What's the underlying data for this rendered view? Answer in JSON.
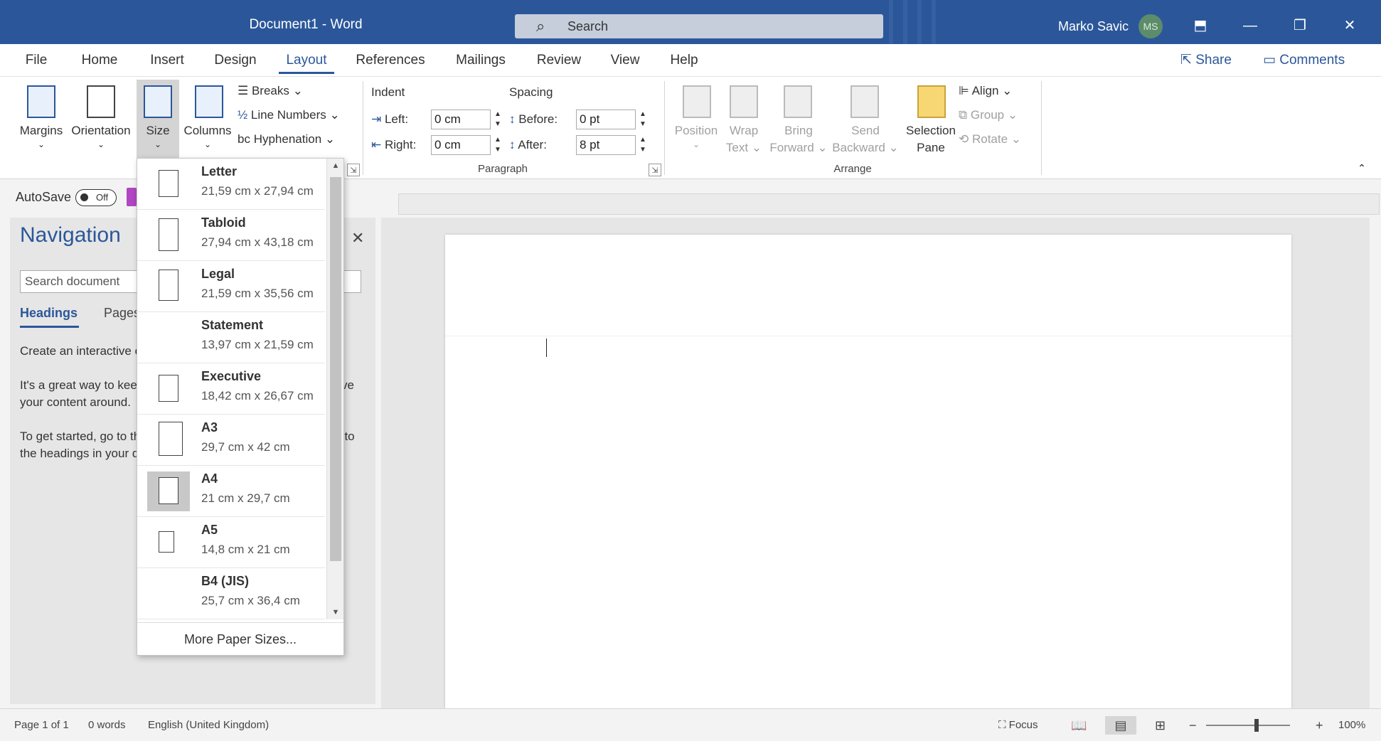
{
  "titlebar": {
    "doc_title": "Document1  -  Word",
    "search_placeholder": "Search",
    "user_name": "Marko Savic",
    "user_initials": "MS",
    "ribbon_display_glyph": "⬒",
    "minimize_glyph": "—",
    "restore_glyph": "❐",
    "close_glyph": "✕"
  },
  "tabs": [
    "File",
    "Home",
    "Insert",
    "Design",
    "Layout",
    "References",
    "Mailings",
    "Review",
    "View",
    "Help"
  ],
  "active_tab": "Layout",
  "share_label": "Share",
  "comments_label": "Comments",
  "ribbon": {
    "page_setup": {
      "margins": "Margins",
      "orientation": "Orientation",
      "size": "Size",
      "columns": "Columns",
      "breaks": "Breaks",
      "line_numbers": "Line Numbers",
      "hyphenation": "Hyphenation"
    },
    "paragraph": {
      "indent_header": "Indent",
      "spacing_header": "Spacing",
      "left_label": "Left:",
      "left_value": "0 cm",
      "right_label": "Right:",
      "right_value": "0 cm",
      "before_label": "Before:",
      "before_value": "0 pt",
      "after_label": "After:",
      "after_value": "8 pt",
      "group_label": "Paragraph"
    },
    "arrange": {
      "position": "Position",
      "wrap_text_1": "Wrap",
      "wrap_text_2": "Text",
      "bring_forward_1": "Bring",
      "bring_forward_2": "Forward",
      "send_backward_1": "Send",
      "send_backward_2": "Backward",
      "selection_pane_1": "Selection",
      "selection_pane_2": "Pane",
      "align": "Align",
      "group": "Group",
      "rotate": "Rotate",
      "group_label": "Arrange"
    }
  },
  "autosave": {
    "label": "AutoSave",
    "state": "Off"
  },
  "navigation": {
    "title": "Navigation",
    "search_placeholder": "Search document",
    "tab_headings": "Headings",
    "tab_pages": "Pages",
    "body_1": "Create an interactive outline of your document.",
    "body_2": "It's a great way to keep track of where you are or quickly move your content around.",
    "body_3": "To get started, go to the Home tab and apply Heading styles to the headings in your document."
  },
  "size_menu": {
    "items": [
      {
        "name": "Letter",
        "dims": "21,59 cm x 27,94 cm"
      },
      {
        "name": "Tabloid",
        "dims": "27,94 cm x 43,18 cm"
      },
      {
        "name": "Legal",
        "dims": "21,59 cm x 35,56 cm"
      },
      {
        "name": "Statement",
        "dims": "13,97 cm x 21,59 cm"
      },
      {
        "name": "Executive",
        "dims": "18,42 cm x 26,67 cm"
      },
      {
        "name": "A3",
        "dims": "29,7 cm x 42 cm"
      },
      {
        "name": "A4",
        "dims": "21 cm x 29,7 cm"
      },
      {
        "name": "A5",
        "dims": "14,8 cm x 21 cm"
      },
      {
        "name": "B4 (JIS)",
        "dims": "25,7 cm x 36,4 cm"
      }
    ],
    "selected": "A4",
    "more": "More Paper Sizes..."
  },
  "status": {
    "page": "Page 1 of 1",
    "words": "0 words",
    "language": "English (United Kingdom)",
    "focus": "Focus",
    "zoom_minus": "−",
    "zoom_plus": "+",
    "zoom": "100%"
  },
  "colors": {
    "accent": "#2b579a",
    "titlebar": "#2b579a"
  }
}
